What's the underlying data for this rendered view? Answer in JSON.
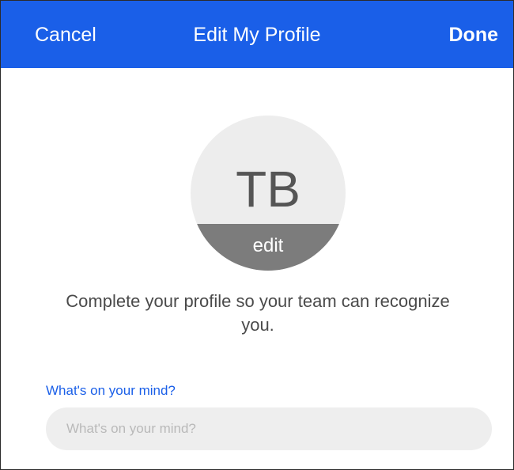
{
  "nav": {
    "cancel_label": "Cancel",
    "title": "Edit My Profile",
    "done_label": "Done"
  },
  "avatar": {
    "initials": "TB",
    "edit_label": "edit"
  },
  "prompt": {
    "text": "Complete your profile so your team can recognize you."
  },
  "status_field": {
    "label": "What's on your mind?",
    "value": "",
    "placeholder": "What's on your mind?"
  },
  "colors": {
    "accent": "#1a5fe8",
    "avatar_bg": "#ededed",
    "avatar_edit_band": "#7c7c7c",
    "input_bg": "#eeeeee"
  }
}
